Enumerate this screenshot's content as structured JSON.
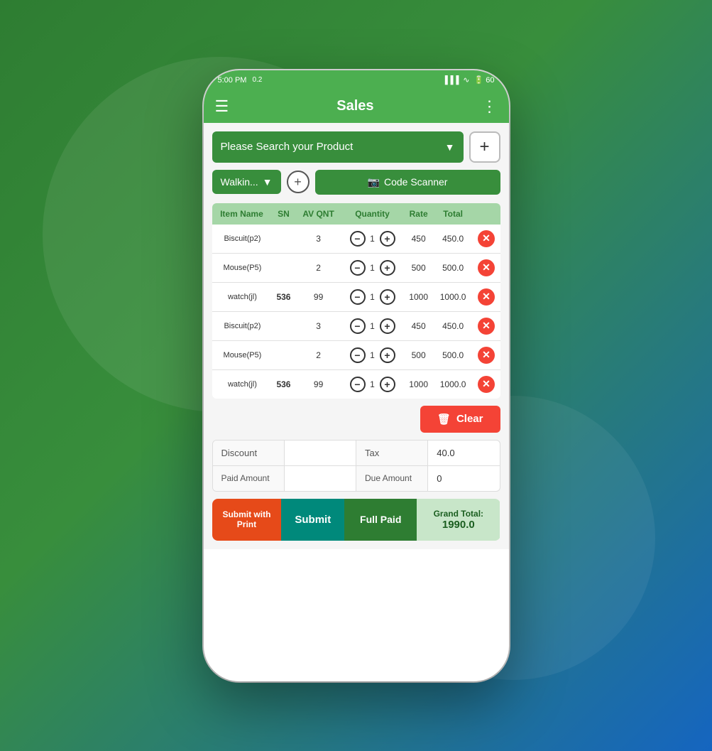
{
  "status_bar": {
    "time": "5:00 PM",
    "signal": "0.2",
    "battery": "60"
  },
  "header": {
    "menu_icon": "☰",
    "title": "Sales",
    "more_icon": "⋮"
  },
  "search": {
    "placeholder": "Please Search your Product",
    "add_label": "+"
  },
  "customer": {
    "name": "Walkin...",
    "add_label": "+",
    "scanner_label": "Code Scanner"
  },
  "table": {
    "headers": [
      "Item Name",
      "SN",
      "AV QNT",
      "Quantity",
      "Rate",
      "Total"
    ],
    "rows": [
      {
        "item": "Biscuit(p2)",
        "sn": "",
        "av_qnt": "3",
        "qty": "1",
        "rate": "450",
        "total": "450.0"
      },
      {
        "item": "Mouse(P5)",
        "sn": "",
        "av_qnt": "2",
        "qty": "1",
        "rate": "500",
        "total": "500.0"
      },
      {
        "item": "watch(jl)",
        "sn": "536",
        "av_qnt": "99",
        "qty": "1",
        "rate": "1000",
        "total": "1000.0"
      },
      {
        "item": "Biscuit(p2)",
        "sn": "",
        "av_qnt": "3",
        "qty": "1",
        "rate": "450",
        "total": "450.0"
      },
      {
        "item": "Mouse(P5)",
        "sn": "",
        "av_qnt": "2",
        "qty": "1",
        "rate": "500",
        "total": "500.0"
      },
      {
        "item": "watch(jl)",
        "sn": "536",
        "av_qnt": "99",
        "qty": "1",
        "rate": "1000",
        "total": "1000.0"
      }
    ]
  },
  "clear_button": "🗑 Clear",
  "summary": {
    "discount_label": "Discount",
    "discount_value": "",
    "tax_label": "Tax",
    "tax_value": "40.0",
    "paid_amount_label": "Paid Amount",
    "paid_amount_value": "",
    "due_amount_label": "Due Amount",
    "due_amount_value": "0"
  },
  "buttons": {
    "submit_print": "Submit with Print",
    "submit": "Submit",
    "full_paid": "Full Paid",
    "grand_total_label": "Grand Total:",
    "grand_total_value": "1990.0"
  }
}
